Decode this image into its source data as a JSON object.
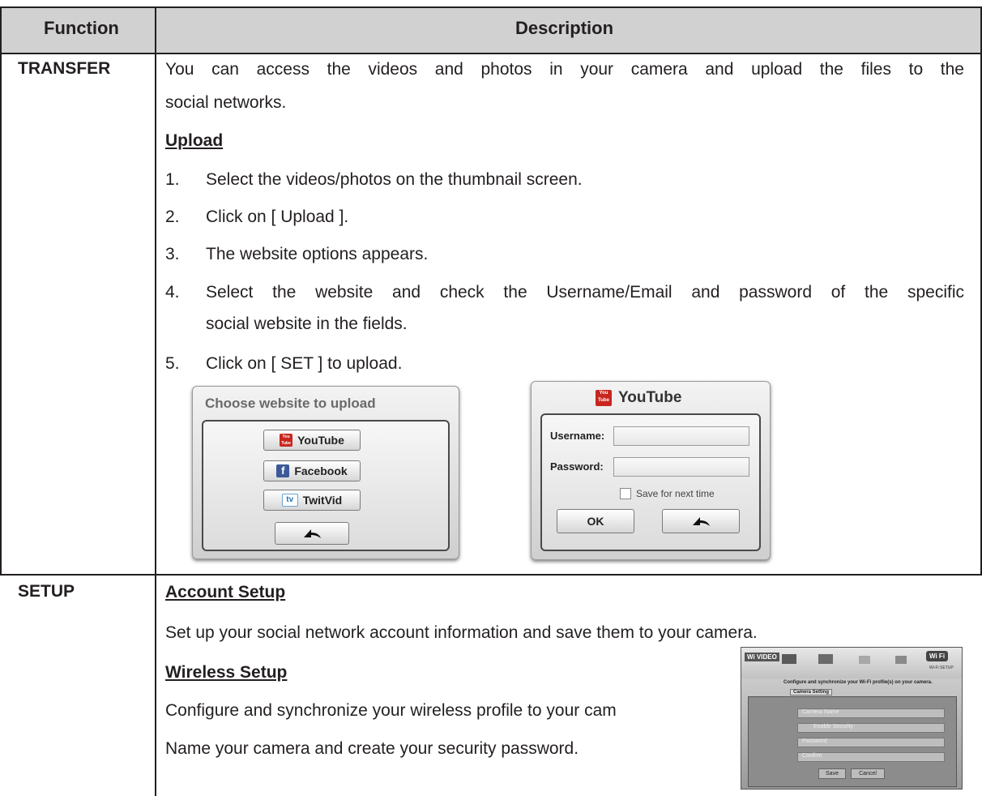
{
  "table": {
    "headers": {
      "function": "Function",
      "description": "Description"
    },
    "transfer": {
      "label": "TRANSFER",
      "intro": "You can access the videos and photos in your camera and upload the files to the",
      "intro_cont": "social networks.",
      "upload_heading": "Upload",
      "steps": [
        {
          "num": "1.",
          "text": "Select the videos/photos on the thumbnail screen."
        },
        {
          "num": "2.",
          "text": "Click on [ Upload ]."
        },
        {
          "num": "3.",
          "text": "The website options appears."
        },
        {
          "num": "4.",
          "text": "Select the website and check the Username/Email and password of the specific",
          "cont": "social website in the fields."
        },
        {
          "num": "5.",
          "text": "Click on [ SET ] to upload."
        }
      ]
    },
    "setup": {
      "label": "SETUP",
      "account_heading": "Account Setup",
      "account_text": "Set up your social network account information and save them to your camera.",
      "wireless_heading": "Wireless Setup",
      "wireless_text": "Configure and synchronize your wireless profile to your cam",
      "name_text": "Name your camera and create your security password."
    }
  },
  "choose_dialog": {
    "title": "Choose website to upload",
    "buttons": [
      "YouTube",
      "Facebook",
      "TwitVid"
    ],
    "icons": [
      "youtube-icon",
      "facebook-icon",
      "twitvid-icon",
      "back-arrow-icon"
    ],
    "youtube_icon_text": "You Tube",
    "facebook_icon_text": "f",
    "twitvid_icon_text": "tv"
  },
  "youtube_dialog": {
    "title": "YouTube",
    "username_label": "Username:",
    "password_label": "Password:",
    "save_label": "Save for next time",
    "ok_label": "OK"
  },
  "wifi_screen": {
    "brand": "Wi VIDEO",
    "badge": "Wi Fi",
    "badge_sub": "Wi-Fi SETUP",
    "banner": "Configure and synchronize your Wi-Fi profile(s) on your camera.",
    "tab": "Camera Setting",
    "fields": [
      "Camera Name",
      "Enable Security",
      "Password",
      "Confirm"
    ],
    "buttons": [
      "Save",
      "Cancel"
    ]
  },
  "colors": {
    "header_bg": "#d1d1d1",
    "text": "#231f20"
  }
}
